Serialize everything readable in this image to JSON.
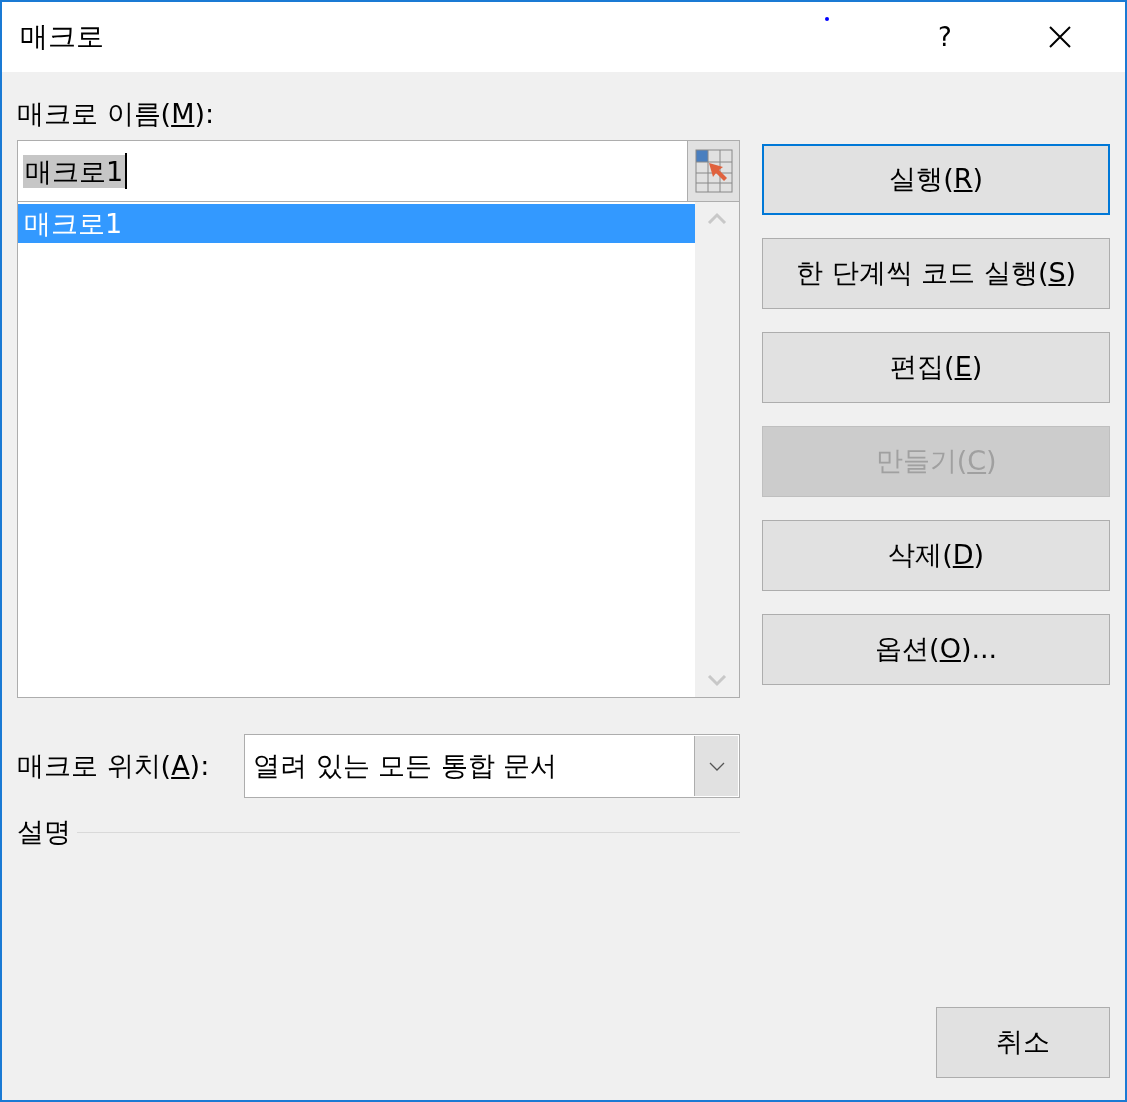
{
  "window": {
    "title": "매크로",
    "help": "?"
  },
  "macro_name": {
    "label": {
      "before": "매크로 이름(",
      "key": "M",
      "after": "):"
    },
    "value": "매크로1",
    "value_selected": true
  },
  "macro_list": {
    "items": [
      {
        "label": "매크로1",
        "selected": true
      }
    ]
  },
  "buttons": [
    {
      "label": {
        "before": "실행(",
        "key": "R",
        "after": ")"
      },
      "default": true,
      "disabled": false
    },
    {
      "label": {
        "before": "한 단계씩 코드 실행(",
        "key": "S",
        "after": ")"
      },
      "default": false,
      "disabled": false
    },
    {
      "label": {
        "before": "편집(",
        "key": "E",
        "after": ")"
      },
      "default": false,
      "disabled": false
    },
    {
      "label": {
        "before": "만들기(",
        "key": "C",
        "after": ")"
      },
      "default": false,
      "disabled": true
    },
    {
      "label": {
        "before": "삭제(",
        "key": "D",
        "after": ")"
      },
      "default": false,
      "disabled": false
    },
    {
      "label": {
        "before": "옵션(",
        "key": "O",
        "after": ")..."
      },
      "default": false,
      "disabled": false
    }
  ],
  "location": {
    "label": {
      "before": "매크로 위치(",
      "key": "A",
      "after": "):"
    },
    "value": "열려 있는 모든 통합 문서"
  },
  "description": {
    "label": "설명"
  },
  "cancel_button": {
    "label": "취소"
  }
}
